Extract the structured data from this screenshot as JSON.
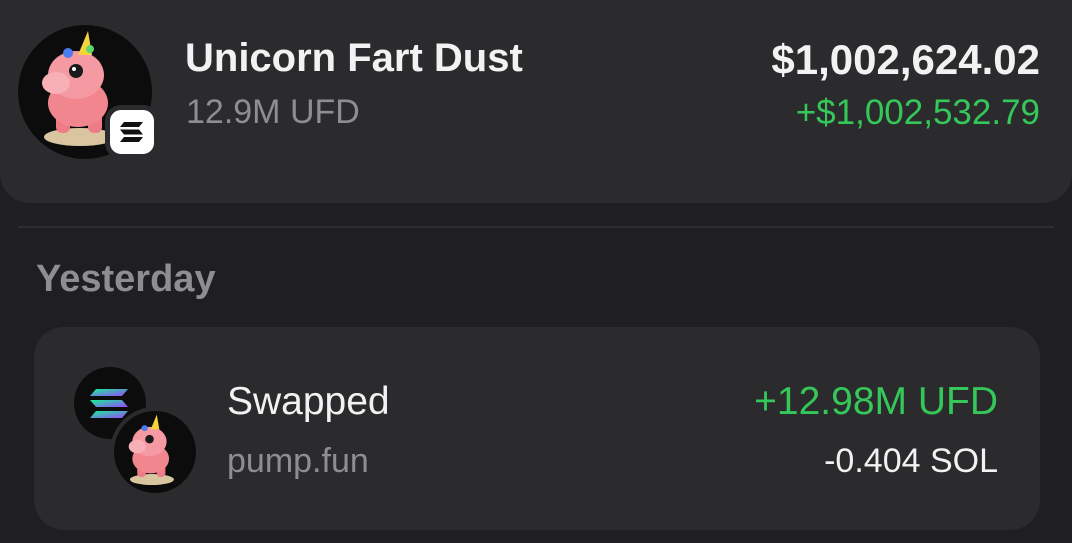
{
  "token": {
    "name": "Unicorn Fart Dust",
    "amount": "12.9M UFD",
    "value": "$1,002,624.02",
    "change": "+$1,002,532.79",
    "avatar_icon": "pink-unicorn-icon",
    "chain_icon": "solana-icon"
  },
  "history": {
    "section_label": "Yesterday",
    "transactions": [
      {
        "title": "Swapped",
        "source": "pump.fun",
        "received": "+12.98M UFD",
        "sent": "-0.404 SOL",
        "from_icon": "solana-icon",
        "to_icon": "pink-unicorn-icon"
      }
    ]
  },
  "colors": {
    "background": "#1f1f21",
    "card": "#2b2b2e",
    "primary_text": "#f2f2f2",
    "secondary_text": "#8e8e92",
    "positive": "#34c759"
  }
}
